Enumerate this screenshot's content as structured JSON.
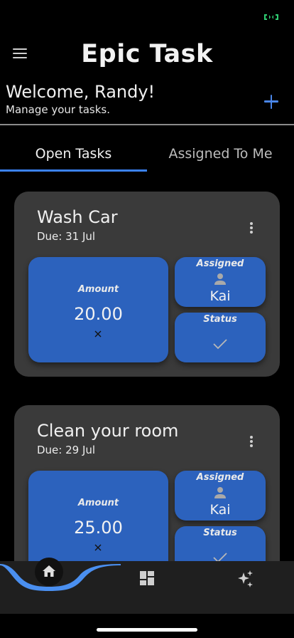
{
  "app": {
    "title": "Epic Task"
  },
  "status_bar": {
    "icons": [
      "battery-icon"
    ]
  },
  "header": {
    "welcome": "Welcome, Randy!",
    "subtitle": "Manage your tasks.",
    "add_icon": "plus-icon",
    "accent_color": "#4a86e8"
  },
  "tabs": [
    {
      "label": "Open Tasks",
      "selected": true
    },
    {
      "label": "Assigned To Me",
      "selected": false
    }
  ],
  "tasks": [
    {
      "name": "Wash Car",
      "due": "Due: 31 Jul",
      "amount_label": "Amount",
      "amount": "20.00",
      "assigned_label": "Assigned",
      "assignee": "Kai",
      "status_label": "Status"
    },
    {
      "name": "Clean your room",
      "due": "Due: 29 Jul",
      "amount_label": "Amount",
      "amount": "25.00",
      "assigned_label": "Assigned",
      "assignee": "Kai",
      "status_label": "Status"
    }
  ],
  "bottom_nav": {
    "items": [
      {
        "icon": "home-icon",
        "selected": true
      },
      {
        "icon": "dashboard-icon",
        "selected": false
      },
      {
        "icon": "sparkle-icon",
        "selected": false
      }
    ]
  },
  "colors": {
    "background": "#000000",
    "card": "#3a3a3a",
    "tile": "#2c62bd",
    "nav": "#1f1f1f",
    "nav_highlight": "#4a8ff0",
    "status_green": "#2ecc71"
  }
}
